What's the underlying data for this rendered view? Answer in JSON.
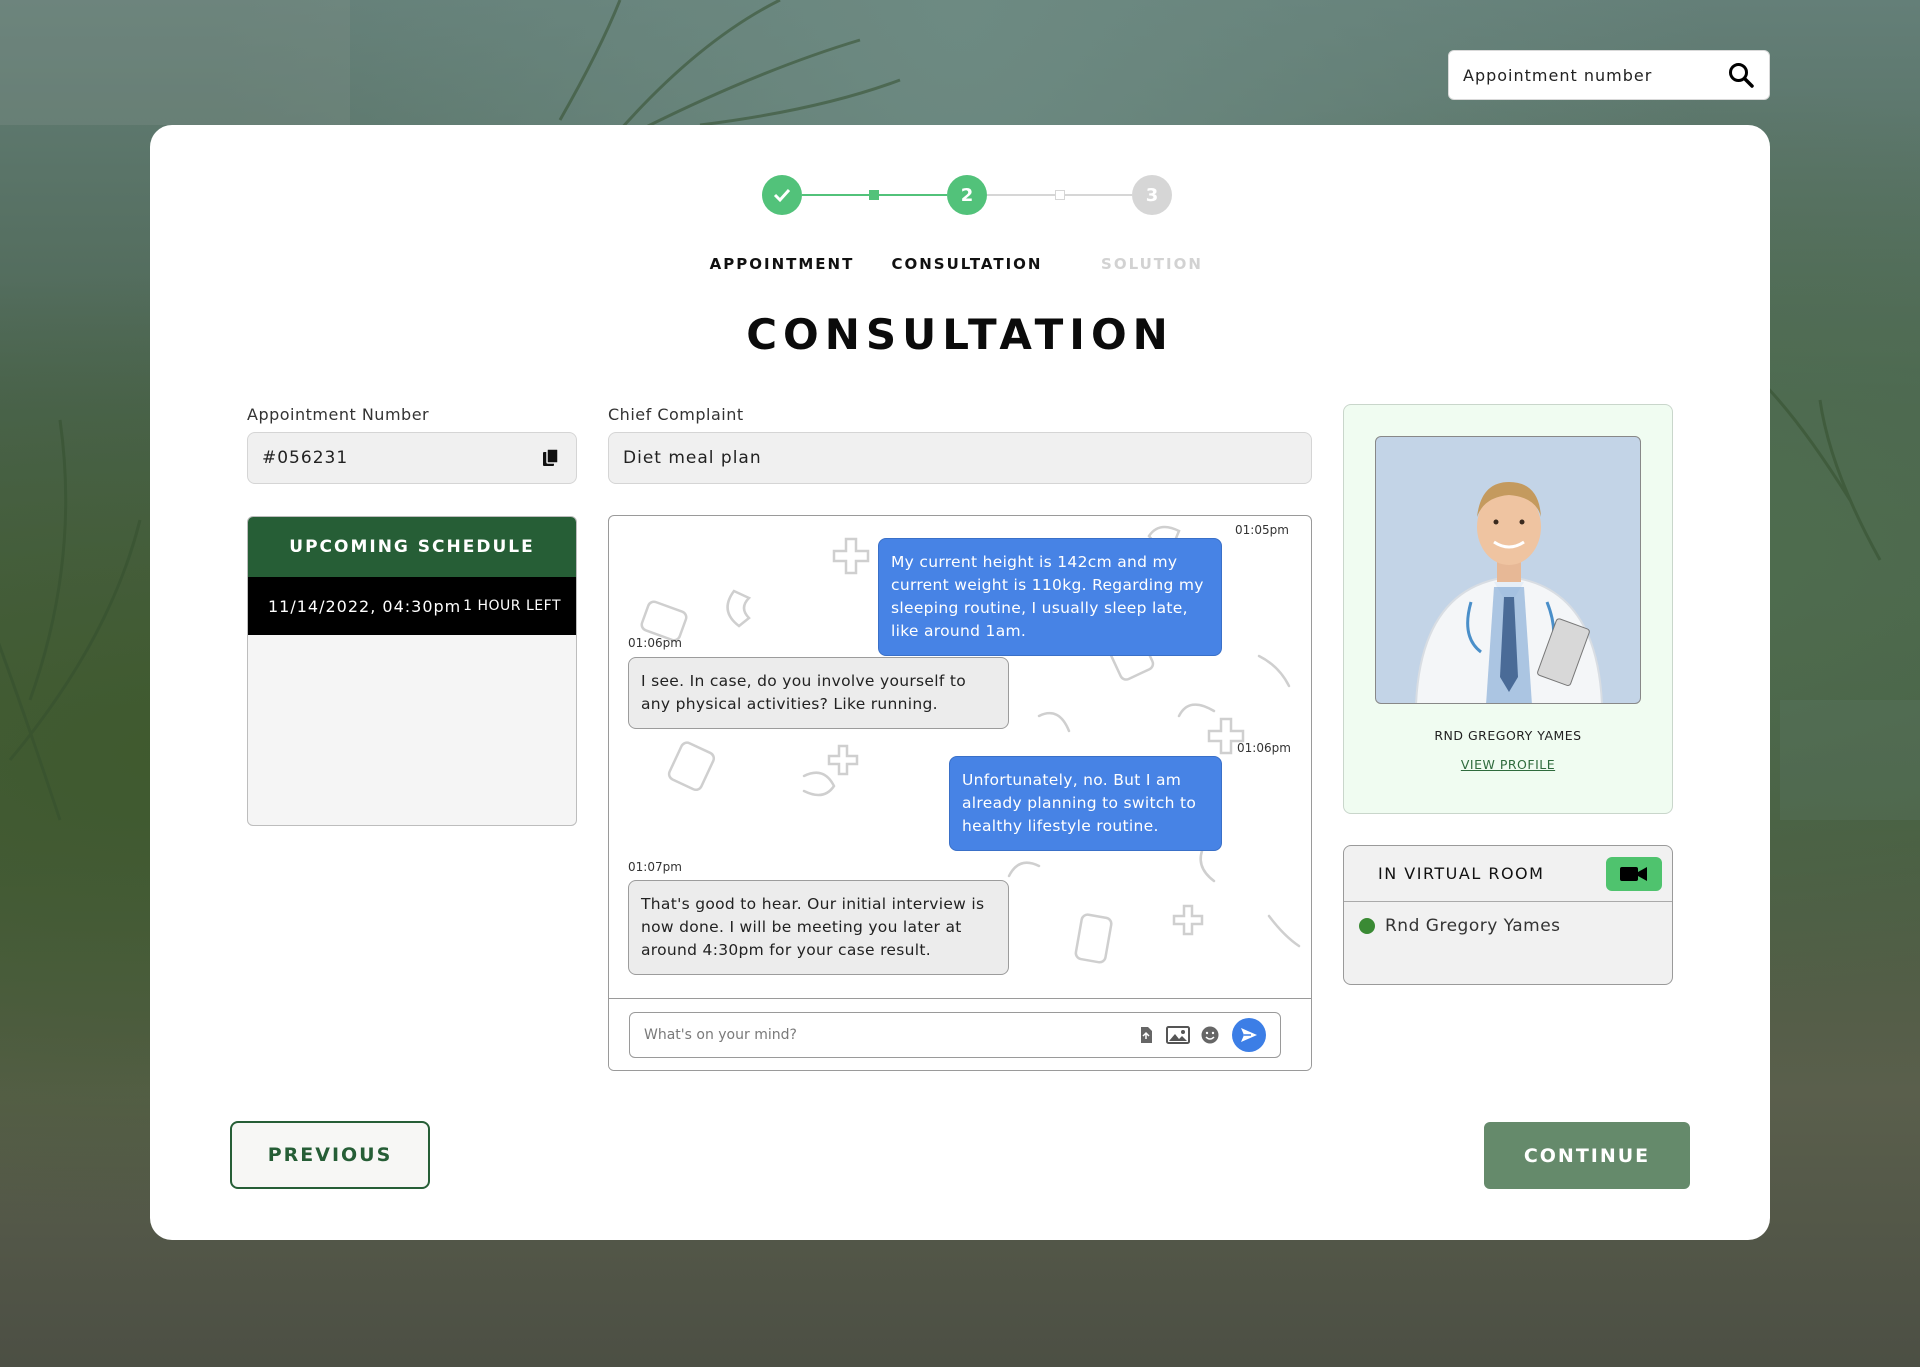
{
  "search": {
    "placeholder": "Appointment number"
  },
  "stepper": {
    "steps": [
      {
        "label": "APPOINTMENT",
        "marker": "",
        "state": "done"
      },
      {
        "label": "CONSULTATION",
        "marker": "2",
        "state": "active"
      },
      {
        "label": "SOLUTION",
        "marker": "3",
        "state": "upcoming"
      }
    ]
  },
  "page": {
    "title": "CONSULTATION"
  },
  "appointment": {
    "label": "Appointment Number",
    "value": "#056231"
  },
  "complaint": {
    "label": "Chief Complaint",
    "value": "Diet meal plan"
  },
  "schedule": {
    "title": "UPCOMING SCHEDULE",
    "date": "11/14/2022, 04:30pm",
    "remaining": "1 HOUR LEFT"
  },
  "chat": {
    "messages": [
      {
        "time": "01:05pm",
        "direction": "outgoing",
        "text": "My current height is 142cm and my current weight is 110kg. Regarding my sleeping routine, I usually sleep late, like around 1am."
      },
      {
        "time": "01:06pm",
        "direction": "incoming",
        "text": "I see. In case, do you involve yourself to any physical activities? Like running."
      },
      {
        "time": "01:06pm",
        "direction": "outgoing",
        "text": "Unfortunately, no. But I am already planning to switch to healthy lifestyle routine."
      },
      {
        "time": "01:07pm",
        "direction": "incoming",
        "text": "That's good to hear. Our initial interview is now done. I will be meeting you later at around 4:30pm for your case result."
      }
    ],
    "input_placeholder": "What's on your mind?"
  },
  "doctor": {
    "name": "RND GREGORY YAMES",
    "profile_link": "VIEW PROFILE"
  },
  "virtual_room": {
    "title": "IN VIRTUAL ROOM",
    "members": [
      {
        "name": "Rnd Gregory Yames",
        "status": "online"
      }
    ]
  },
  "nav": {
    "previous": "PREVIOUS",
    "continue": "CONTINUE"
  },
  "colors": {
    "brand_green": "#265e36",
    "step_green": "#52c27a",
    "bubble_blue": "#4783e5",
    "continue_bg": "#658a6b",
    "doctor_card_bg": "#f0fcf1"
  }
}
